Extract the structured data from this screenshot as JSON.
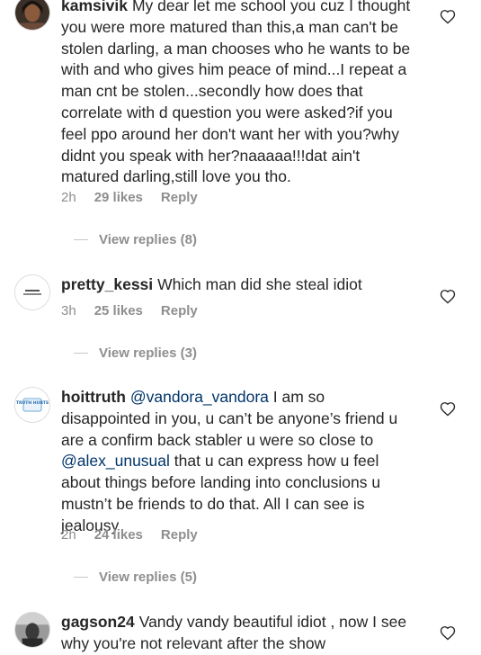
{
  "comments": [
    {
      "username": "kamsivik",
      "text": "My dear let me school you cuz I thought you were more matured than this,a man can't be stolen darling, a man chooses who he wants to be with and who gives him peace of mind...I repeat a man cnt be stolen...secondly how does that correlate with d question you were asked?if you feel ppo around her don't want her with you?why didnt you speak with her?naaaaa!!!dat ain't matured darling,still love you tho.",
      "time": "2h",
      "likes": "29 likes",
      "reply": "Reply",
      "view_replies": "View replies (8)"
    },
    {
      "username": "pretty_kessi",
      "text": "Which man did she steal idiot",
      "time": "3h",
      "likes": "25 likes",
      "reply": "Reply",
      "view_replies": "View replies (3)"
    },
    {
      "username": "hoittruth",
      "mention1": "@vandora_vandora",
      "text1": " I am so disappointed in you, u can’t be anyone’s friend u are a confirm back stabler u were so close to ",
      "mention2": "@alex_unusual",
      "text2": " that u can express how u feel about things before landing into conclusions u mustn’t be friends to do that. All I can see is jealousy",
      "time": "2h",
      "likes": "24 likes",
      "reply": "Reply",
      "view_replies": "View replies (5)"
    },
    {
      "username": "gagson24",
      "text": "Vandy vandy beautiful idiot , now I see why you're not relevant after the show"
    }
  ],
  "avatar_text": {
    "truth_hurts": "TRUTH HURTS"
  },
  "colors": {
    "text": "#262626",
    "meta": "#8e8e8e",
    "mention": "#003569",
    "divider": "#c7c7c7"
  },
  "icons": [
    "heart-icon"
  ]
}
